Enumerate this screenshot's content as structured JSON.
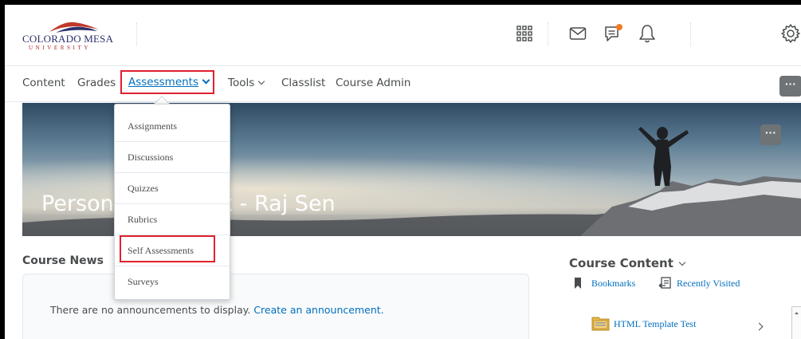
{
  "header": {
    "logo_name": "COLORADO MESA",
    "logo_sub": "UNIVERSITY",
    "icons": [
      "waffle-grid-icon",
      "mail-icon",
      "chat-notification-icon",
      "bell-icon",
      "gear-icon"
    ],
    "notification_dot_color": "#f47b20"
  },
  "nav": {
    "items": [
      "Content",
      "Grades",
      "Assessments",
      "Tools",
      "Classlist",
      "Course Admin"
    ],
    "more_label": "···"
  },
  "dropdown": {
    "items": [
      "Assignments",
      "Discussions",
      "Quizzes",
      "Rubrics",
      "Self Assessments",
      "Surveys"
    ]
  },
  "banner": {
    "title": "Personal Sandbox - Raj Sen",
    "more_label": "···"
  },
  "news": {
    "title": "Course News",
    "empty_text": "There are no announcements to display. ",
    "create_link": "Create an announcement."
  },
  "course_content": {
    "title": "Course Content",
    "bookmarks": "Bookmarks",
    "recently_visited": "Recently Visited",
    "item": "HTML Template Test"
  },
  "colors": {
    "link": "#006fbf",
    "highlight_box": "#e0202f",
    "text": "#494c4e"
  }
}
